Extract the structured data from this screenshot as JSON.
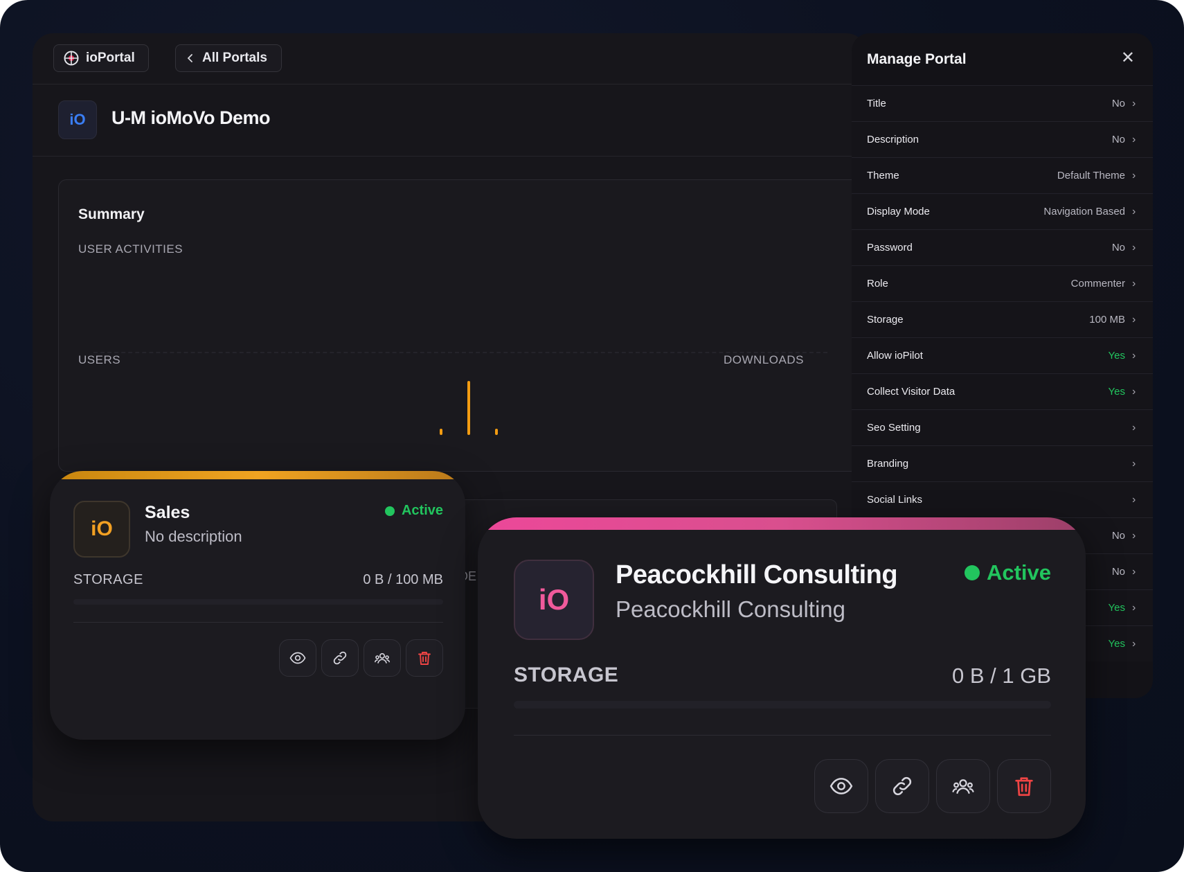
{
  "colors": {
    "background": "#0c1120",
    "surface": "#17161b",
    "accent_blue": "#3a7ef5",
    "accent_orange": "#f39c12",
    "accent_pink": "#ec4899",
    "status_green": "#22c55e",
    "delete_red": "#ef4444"
  },
  "topbar": {
    "logo_icon": "ioportal-logo-icon",
    "logo_label": "ioPortal",
    "back_icon": "chevron-left-icon",
    "back_label": "All Portals"
  },
  "portal": {
    "badge": "iO",
    "title": "U-M ioMoVo Demo"
  },
  "summary": {
    "heading": "Summary",
    "user_activities_label": "USER ACTIVITIES",
    "users_label": "USERS",
    "downloads_label": "DOWNLOADS"
  },
  "behind_card": {
    "fragment": "DE"
  },
  "manage_panel": {
    "title": "Manage Portal",
    "close_icon": "close-icon",
    "rows": [
      {
        "label": "Title",
        "value": "No"
      },
      {
        "label": "Description",
        "value": "No"
      },
      {
        "label": "Theme",
        "value": "Default Theme"
      },
      {
        "label": "Display Mode",
        "value": "Navigation Based"
      },
      {
        "label": "Password",
        "value": "No"
      },
      {
        "label": "Role",
        "value": "Commenter"
      },
      {
        "label": "Storage",
        "value": "100 MB"
      },
      {
        "label": "Allow ioPilot",
        "value": "Yes"
      },
      {
        "label": "Collect Visitor Data",
        "value": "Yes"
      },
      {
        "label": "Seo Setting",
        "value": ""
      },
      {
        "label": "Branding",
        "value": ""
      },
      {
        "label": "Social Links",
        "value": ""
      },
      {
        "label": "",
        "value": "No"
      },
      {
        "label": "",
        "value": "No"
      },
      {
        "label": "",
        "value": "Yes"
      },
      {
        "label": "",
        "value": "Yes"
      }
    ]
  },
  "cards": {
    "sales": {
      "logo": "iO",
      "title": "Sales",
      "description": "No description",
      "status": "Active",
      "storage_label": "STORAGE",
      "storage_value": "0 B / 100 MB",
      "storage_fraction": 0,
      "actions": [
        "eye-icon",
        "link-icon",
        "users-icon",
        "trash-icon"
      ]
    },
    "peacock": {
      "logo": "iO",
      "title": "Peacockhill Consulting",
      "description": "Peacockhill Consulting",
      "status": "Active",
      "storage_label": "STORAGE",
      "storage_value": "0 B / 1 GB",
      "storage_fraction": 0,
      "actions": [
        "eye-icon",
        "link-icon",
        "users-icon",
        "trash-icon"
      ]
    }
  }
}
